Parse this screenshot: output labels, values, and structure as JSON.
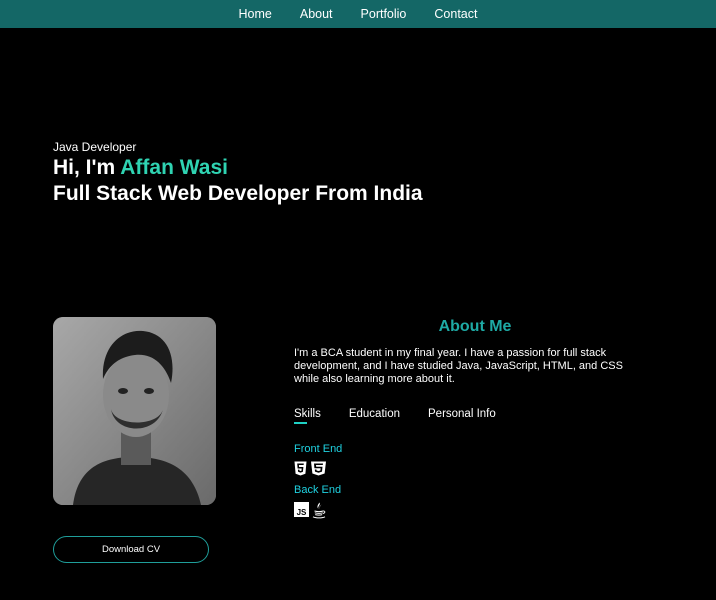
{
  "nav": {
    "items": [
      {
        "label": "Home"
      },
      {
        "label": "About"
      },
      {
        "label": "Portfolio"
      },
      {
        "label": "Contact"
      }
    ]
  },
  "hero": {
    "role": "Java Developer",
    "greeting": "Hi, I'm ",
    "name": "Affan Wasi",
    "tagline": "Full Stack Web Developer From India"
  },
  "about": {
    "title": "About Me",
    "description": "I'm a BCA student in my final year. I have a passion for full stack development, and I have studied Java, JavaScript, HTML, and CSS while also learning more about it.",
    "tabs": [
      {
        "label": "Skills",
        "active": true
      },
      {
        "label": "Education",
        "active": false
      },
      {
        "label": "Personal Info",
        "active": false
      }
    ],
    "front_end_label": "Front End",
    "back_end_label": "Back End",
    "front_end_icons": [
      "html5-icon",
      "css3-icon"
    ],
    "back_end_icons": [
      "javascript-icon",
      "java-icon"
    ]
  },
  "download_cv": {
    "label": "Download CV"
  },
  "colors": {
    "navbar": "#146766",
    "accent_name": "#2fd3b2",
    "about_title": "#1eaaa5",
    "skill_heading": "#1fd1e0",
    "button_border": "#1f9e9a"
  }
}
